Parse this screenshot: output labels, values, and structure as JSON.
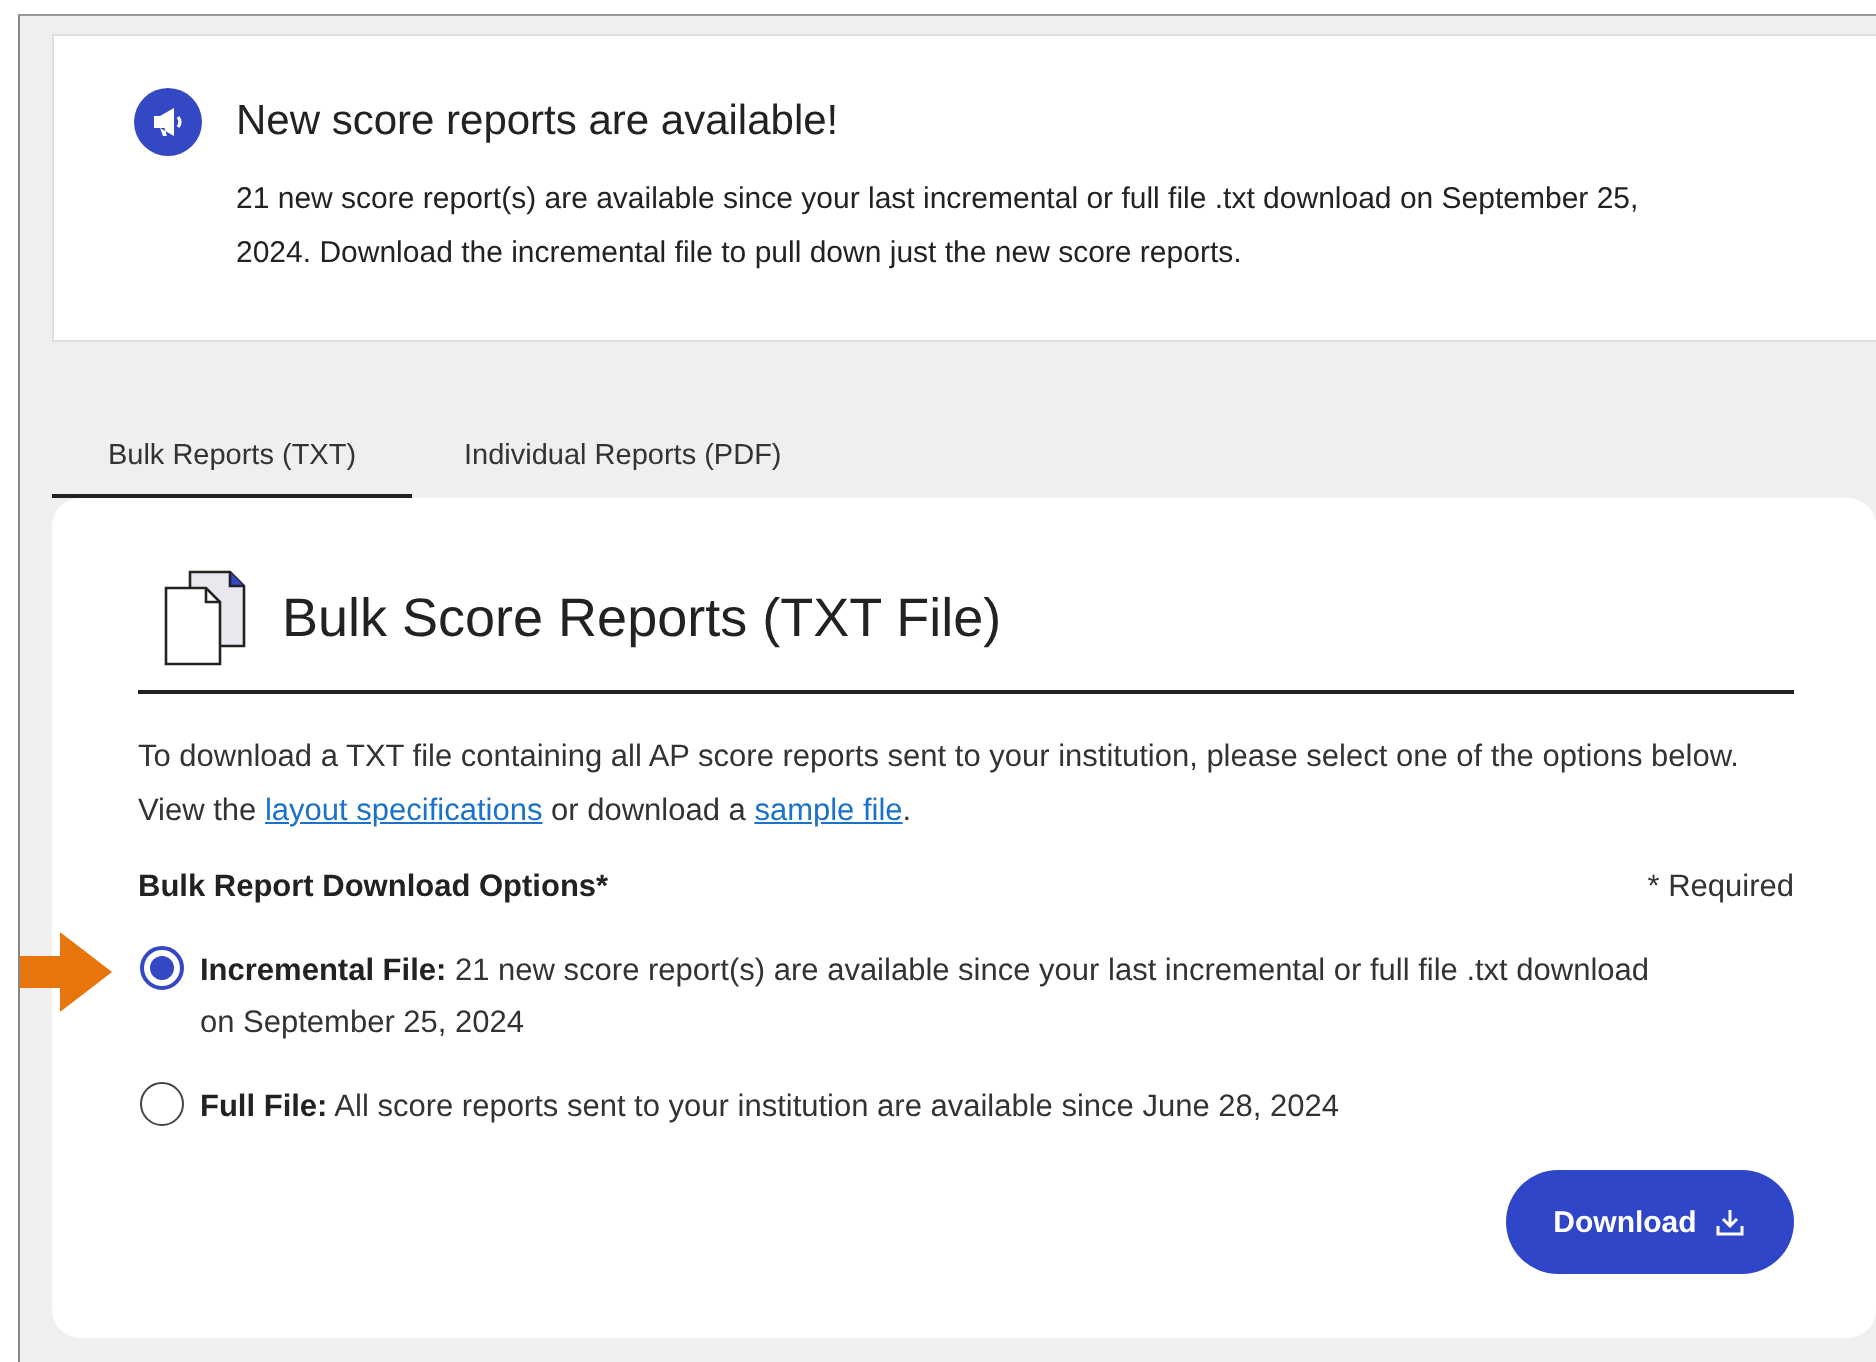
{
  "alert": {
    "title": "New score reports are available!",
    "message": "21 new score report(s) are available since your last incremental or full file .txt download on September 25, 2024. Download the incremental file to pull down just the new score reports."
  },
  "tabs": [
    {
      "label": "Bulk Reports (TXT)",
      "selected": true
    },
    {
      "label": "Individual Reports (PDF)",
      "selected": false
    }
  ],
  "panel": {
    "title": "Bulk Score Reports (TXT File)",
    "description": [
      {
        "kind": "text",
        "text": "To download a TXT file containing all AP score reports sent to your institution, please select one of the options below. View the "
      },
      {
        "kind": "link",
        "text": "layout specifications"
      },
      {
        "kind": "text",
        "text": " or download a "
      },
      {
        "kind": "link",
        "text": "sample file"
      },
      {
        "kind": "text",
        "text": "."
      }
    ],
    "options_label": "Bulk Report Download Options*",
    "required_note": "* Required",
    "options": [
      {
        "text": "**Incremental File:** 21 new score report(s) are available since your last incremental or full file .txt download on September 25, 2024",
        "selected": true,
        "pointed": true
      },
      {
        "text": "**Full File:** All score reports sent to your institution are available since June 28, 2024",
        "selected": false,
        "pointed": false
      }
    ],
    "button": "Download"
  }
}
